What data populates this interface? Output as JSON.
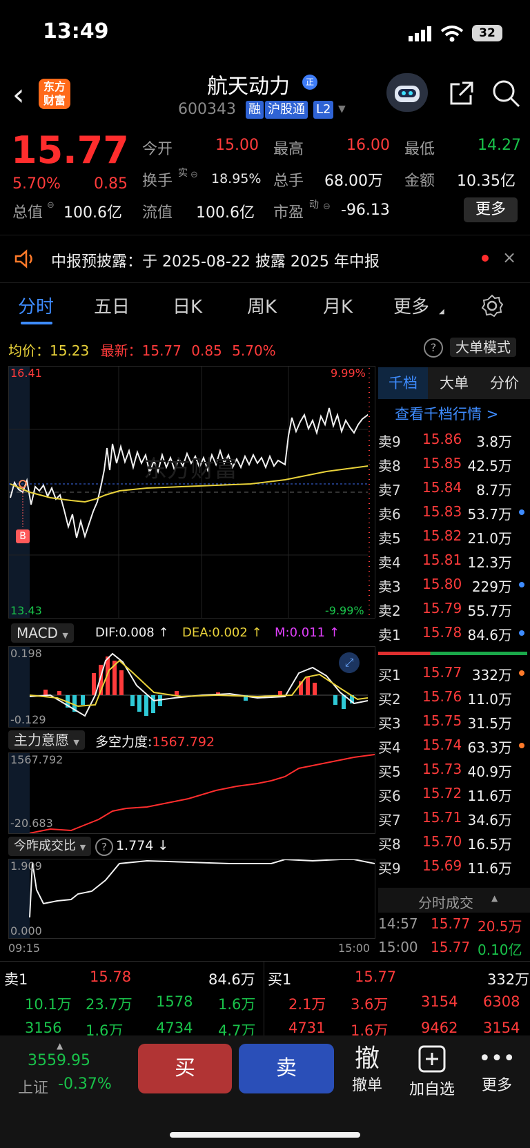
{
  "status_bar": {
    "time": "13:49",
    "battery": "32"
  },
  "header": {
    "logo_text_1": "东方",
    "logo_text_2": "财富",
    "stock_name": "航天动力",
    "name_badge": "正",
    "code": "600343",
    "tags": [
      "融",
      "沪股通",
      "L2"
    ]
  },
  "quote": {
    "price": "15.77",
    "change_pct": "5.70%",
    "change": "0.85",
    "open_label": "今开",
    "open": "15.00",
    "high_label": "最高",
    "high": "16.00",
    "low_label": "最低",
    "low": "14.27",
    "turnover_label": "换手",
    "turnover_sup": "实",
    "turnover": "18.95%",
    "volume_label": "总手",
    "volume": "68.00万",
    "amount_label": "金额",
    "amount": "10.35亿",
    "mktcap_label": "总值",
    "mktcap": "100.6亿",
    "float_label": "流值",
    "float": "100.6亿",
    "pe_label": "市盈",
    "pe_sup": "动",
    "pe": "-96.13",
    "more": "更多"
  },
  "notice": {
    "text": "中报预披露：于 2025-08-22 披露 2025 年中报"
  },
  "tabs": [
    "分时",
    "五日",
    "日K",
    "周K",
    "月K",
    "更多"
  ],
  "avg_line": {
    "avg_label": "均价：",
    "avg": "15.23",
    "latest_label": "最新：",
    "latest": "15.77",
    "chg": "0.85",
    "pct": "5.70%",
    "mode": "大单模式"
  },
  "main_chart": {
    "top_price": "16.41",
    "bottom_price": "13.43",
    "top_pct": "9.99%",
    "bottom_pct": "-9.99%",
    "watermark": "东方财富",
    "buy_marker": "B"
  },
  "macd": {
    "name": "MACD",
    "dif": "DIF:0.008 ↑",
    "dea": "DEA:0.002 ↑",
    "m": "M:0.011 ↑",
    "top": "0.198",
    "bottom": "-0.129"
  },
  "mainforce": {
    "name": "主力意愿",
    "label": "多空力度:",
    "value": "1567.792",
    "top": "1567.792",
    "bottom": "-20.683"
  },
  "volratio": {
    "name": "今昨成交比",
    "value": "1.774 ↓",
    "top": "1.909",
    "bottom": "0.000",
    "x_start": "09:15",
    "x_end": "15:00"
  },
  "book": {
    "tabs": [
      "千档",
      "大单",
      "分价"
    ],
    "view": "查看千档行情 >",
    "asks": [
      {
        "label": "卖9",
        "price": "15.86",
        "vol": "3.8万"
      },
      {
        "label": "卖8",
        "price": "15.85",
        "vol": "42.5万"
      },
      {
        "label": "卖7",
        "price": "15.84",
        "vol": "8.7万"
      },
      {
        "label": "卖6",
        "price": "15.83",
        "vol": "53.7万"
      },
      {
        "label": "卖5",
        "price": "15.82",
        "vol": "21.0万"
      },
      {
        "label": "卖4",
        "price": "15.81",
        "vol": "12.3万"
      },
      {
        "label": "卖3",
        "price": "15.80",
        "vol": "229万"
      },
      {
        "label": "卖2",
        "price": "15.79",
        "vol": "55.7万"
      },
      {
        "label": "卖1",
        "price": "15.78",
        "vol": "84.6万"
      }
    ],
    "bids": [
      {
        "label": "买1",
        "price": "15.77",
        "vol": "332万"
      },
      {
        "label": "买2",
        "price": "15.76",
        "vol": "11.0万"
      },
      {
        "label": "买3",
        "price": "15.75",
        "vol": "31.5万"
      },
      {
        "label": "买4",
        "price": "15.74",
        "vol": "63.3万"
      },
      {
        "label": "买5",
        "price": "15.73",
        "vol": "40.9万"
      },
      {
        "label": "买6",
        "price": "15.72",
        "vol": "11.6万"
      },
      {
        "label": "买7",
        "price": "15.71",
        "vol": "34.6万"
      },
      {
        "label": "买8",
        "price": "15.70",
        "vol": "16.5万"
      },
      {
        "label": "买9",
        "price": "15.69",
        "vol": "11.6万"
      }
    ],
    "ticks_label": "分时成交",
    "ticks": [
      {
        "time": "14:57",
        "price": "15.77",
        "vol": "20.5万"
      },
      {
        "time": "15:00",
        "price": "15.77",
        "vol": "0.10亿"
      }
    ]
  },
  "queue": {
    "ask_label": "卖1",
    "ask_price": "15.78",
    "ask_vol": "84.6万",
    "bid_label": "买1",
    "bid_price": "15.77",
    "bid_vol": "332万",
    "ask_rows": [
      [
        "10.1万",
        "23.7万",
        "1578",
        "1.6万"
      ],
      [
        "3156",
        "1.6万",
        "4734",
        "4.7万"
      ]
    ],
    "bid_rows": [
      [
        "2.1万",
        "3.6万",
        "3154",
        "6308"
      ],
      [
        "4731",
        "1.6万",
        "9462",
        "3154"
      ]
    ]
  },
  "bottom": {
    "index_value": "3559.95",
    "index_name": "上证",
    "index_pct": "-0.37%",
    "buy": "买",
    "sell": "卖",
    "cancel_icon": "撤",
    "cancel": "撤单",
    "watch": "加自选",
    "more": "更多"
  }
}
